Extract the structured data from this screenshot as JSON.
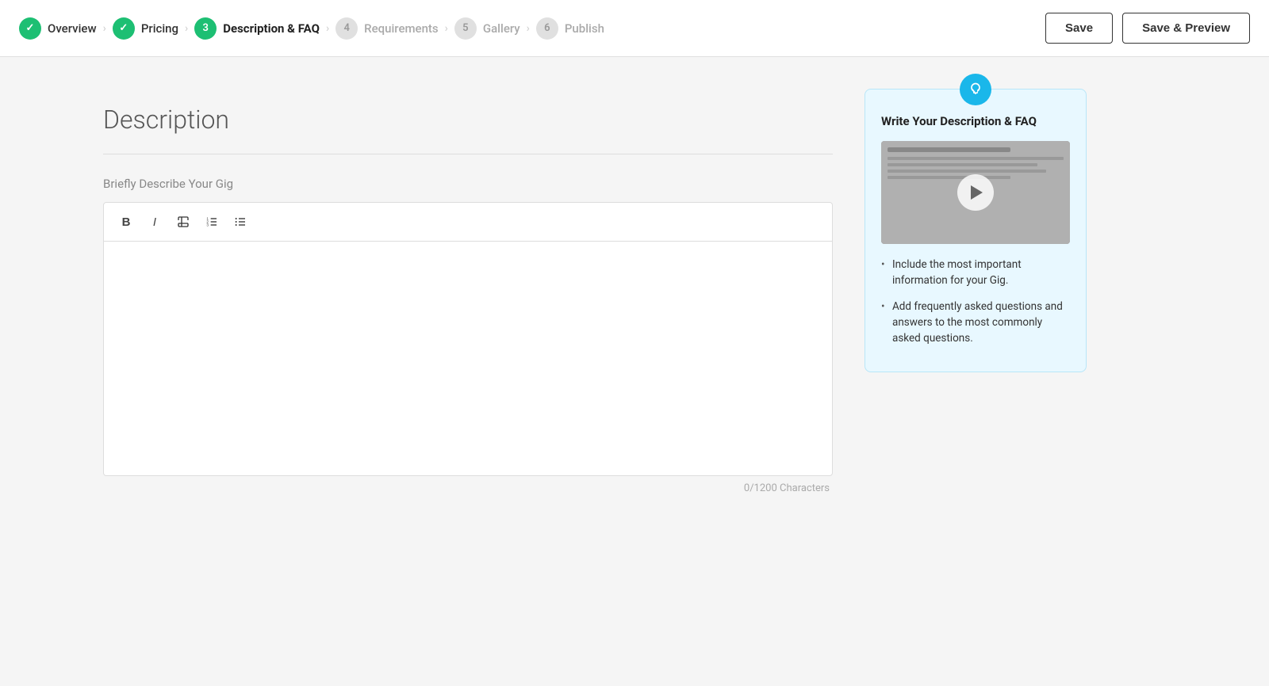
{
  "header": {
    "steps": [
      {
        "id": "overview",
        "label": "Overview",
        "state": "completed",
        "number": "✓"
      },
      {
        "id": "pricing",
        "label": "Pricing",
        "state": "completed",
        "number": "✓"
      },
      {
        "id": "description",
        "label": "Description & FAQ",
        "state": "active",
        "number": "3"
      },
      {
        "id": "requirements",
        "label": "Requirements",
        "state": "inactive",
        "number": "4"
      },
      {
        "id": "gallery",
        "label": "Gallery",
        "state": "inactive",
        "number": "5"
      },
      {
        "id": "publish",
        "label": "Publish",
        "state": "inactive",
        "number": "6"
      }
    ],
    "save_label": "Save",
    "save_preview_label": "Save & Preview"
  },
  "main": {
    "section_title": "Description",
    "field_label": "Briefly Describe Your Gig",
    "editor_placeholder": "",
    "char_count": "0/1200 Characters",
    "toolbar": {
      "bold": "B",
      "italic": "I",
      "highlight": "🖊",
      "ordered_list": "≡",
      "unordered_list": "≡"
    }
  },
  "sidebar": {
    "tip_title": "Write Your Description & FAQ",
    "bullet1": "Include the most important information for your Gig.",
    "bullet2": "Add frequently asked questions and answers to the most commonly asked questions."
  }
}
